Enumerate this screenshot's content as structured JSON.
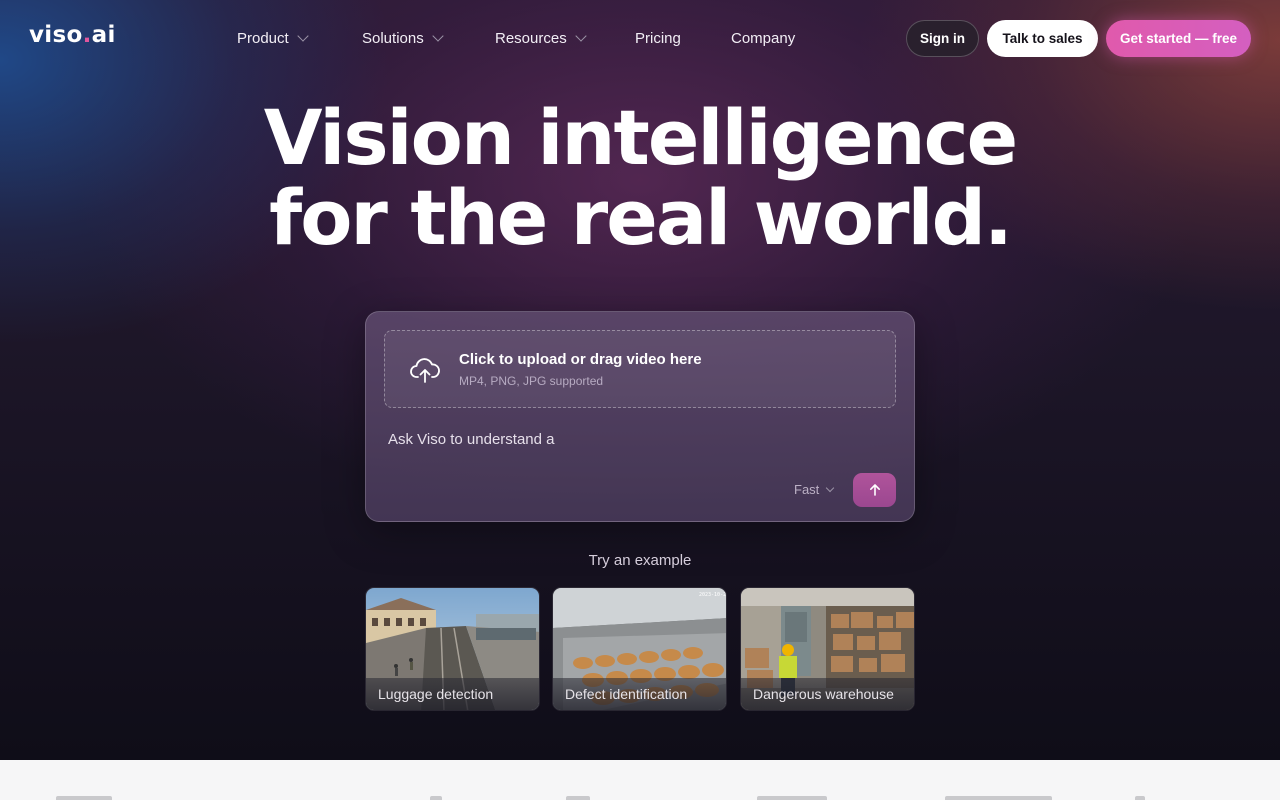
{
  "brand": {
    "name": "viso",
    "dot": ".",
    "suffix": "ai"
  },
  "nav": {
    "items": [
      {
        "label": "Product",
        "has_dropdown": true
      },
      {
        "label": "Solutions",
        "has_dropdown": true
      },
      {
        "label": "Resources",
        "has_dropdown": true
      },
      {
        "label": "Pricing",
        "has_dropdown": false
      },
      {
        "label": "Company",
        "has_dropdown": false
      }
    ],
    "sign_in": "Sign in",
    "talk_to_sales": "Talk to sales",
    "get_started": "Get started — free"
  },
  "hero": {
    "headline_line1": "Vision intelligence",
    "headline_line2": "for the real world."
  },
  "composer": {
    "upload_title": "Click to upload or drag video here",
    "upload_subtitle": "MP4, PNG, JPG supported",
    "prompt_value": "Ask Viso to understand a",
    "model": "Fast",
    "send_icon": "arrow-up-icon",
    "upload_icon": "cloud-upload-icon"
  },
  "examples": {
    "label": "Try an example",
    "cards": [
      {
        "label": "Luggage detection"
      },
      {
        "label": "Defect identification",
        "overlay_text": "2023-10-28"
      },
      {
        "label": "Dangerous warehouse"
      }
    ]
  },
  "colors": {
    "accent": "#e05aac",
    "send_button": "#a44d95",
    "footer_strip": "#f6f6f7"
  }
}
